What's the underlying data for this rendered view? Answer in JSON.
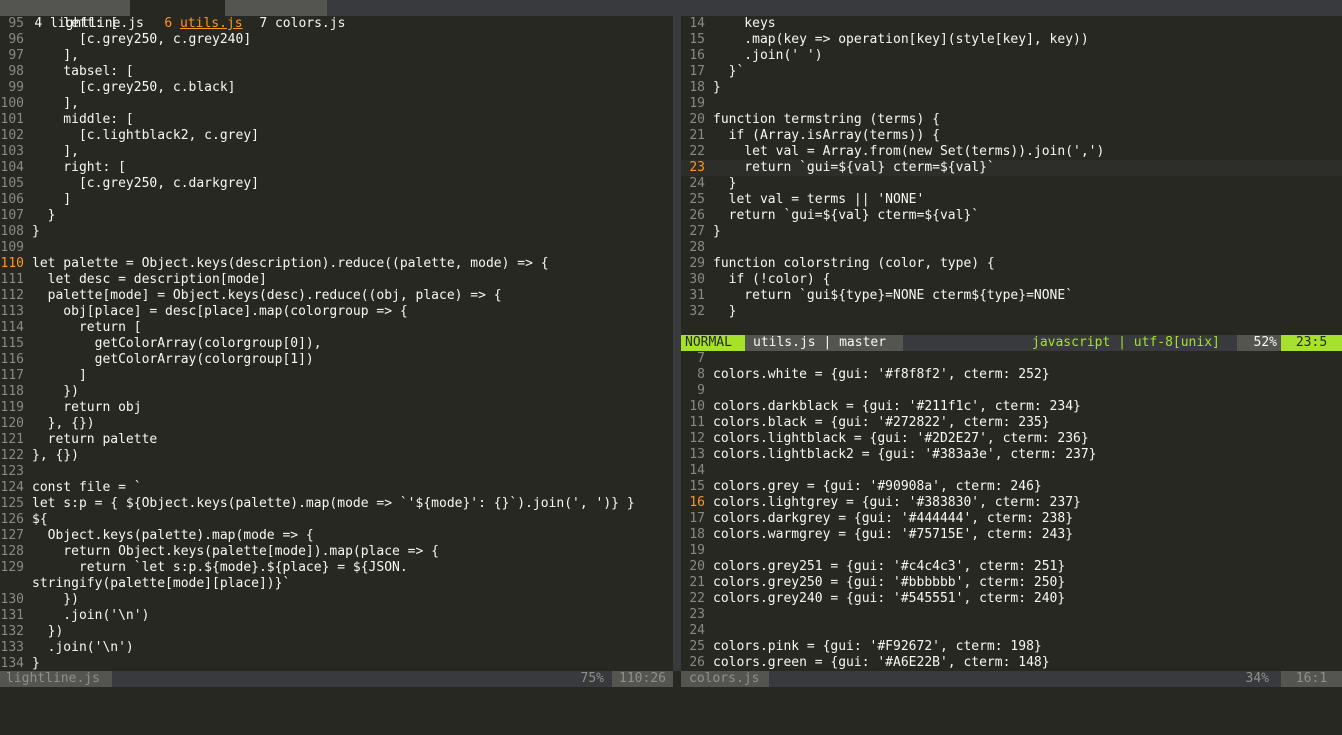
{
  "colors": {
    "bg": "#272822",
    "fg": "#f8f8f2",
    "grey": "#90908a",
    "pink": "#F92672",
    "green": "#A6E22B",
    "orange": "#FD971F",
    "yellow": "#E6DB74",
    "purple": "#AE81FF",
    "blue": "#66D9EF",
    "tabline_bg": "#383a3e"
  },
  "tabs": [
    {
      "number": "4",
      "name": "lightline.js",
      "active": false
    },
    {
      "number": "6",
      "name": "utils.js",
      "active": true
    },
    {
      "number": "7",
      "name": "colors.js",
      "active": false
    }
  ],
  "left_pane": {
    "filename": "lightline.js",
    "percent": "75%",
    "position": "110:26",
    "cursor_line": "110",
    "lines": [
      {
        "n": "95",
        "t": "    left: ["
      },
      {
        "n": "96",
        "t": "      [c.grey250, c.grey240]"
      },
      {
        "n": "97",
        "t": "    ],"
      },
      {
        "n": "98",
        "t": "    tabsel: ["
      },
      {
        "n": "99",
        "t": "      [c.grey250, c.black]"
      },
      {
        "n": "100",
        "t": "    ],"
      },
      {
        "n": "101",
        "t": "    middle: ["
      },
      {
        "n": "102",
        "t": "      [c.lightblack2, c.grey]"
      },
      {
        "n": "103",
        "t": "    ],"
      },
      {
        "n": "104",
        "t": "    right: ["
      },
      {
        "n": "105",
        "t": "      [c.grey250, c.darkgrey]"
      },
      {
        "n": "106",
        "t": "    ]"
      },
      {
        "n": "107",
        "t": "  }"
      },
      {
        "n": "108",
        "t": "}"
      },
      {
        "n": "109",
        "t": ""
      },
      {
        "n": "110",
        "t": "let palette = Object.keys(description).reduce((palette, mode) => {"
      },
      {
        "n": "111",
        "t": "  let desc = description[mode]"
      },
      {
        "n": "112",
        "t": "  palette[mode] = Object.keys(desc).reduce((obj, place) => {"
      },
      {
        "n": "113",
        "t": "    obj[place] = desc[place].map(colorgroup => {"
      },
      {
        "n": "114",
        "t": "      return ["
      },
      {
        "n": "115",
        "t": "        getColorArray(colorgroup[0]),"
      },
      {
        "n": "116",
        "t": "        getColorArray(colorgroup[1])"
      },
      {
        "n": "117",
        "t": "      ]"
      },
      {
        "n": "118",
        "t": "    })"
      },
      {
        "n": "119",
        "t": "    return obj"
      },
      {
        "n": "120",
        "t": "  }, {})"
      },
      {
        "n": "121",
        "t": "  return palette"
      },
      {
        "n": "122",
        "t": "}, {})"
      },
      {
        "n": "123",
        "t": ""
      },
      {
        "n": "124",
        "t": "const file = `"
      },
      {
        "n": "125",
        "t": "let s:p = { ${Object.keys(palette).map(mode => `'${mode}': {}`).join(', ')} }"
      },
      {
        "n": "126",
        "t": "${"
      },
      {
        "n": "127",
        "t": "  Object.keys(palette).map(mode => {"
      },
      {
        "n": "128",
        "t": "    return Object.keys(palette[mode]).map(place => {"
      },
      {
        "n": "129",
        "t": "      return `let s:p.${mode}.${place} = ${JSON."
      },
      {
        "n": "",
        "t": "stringify(palette[mode][place])}`"
      },
      {
        "n": "130",
        "t": "    })"
      },
      {
        "n": "131",
        "t": "    .join('\\n')"
      },
      {
        "n": "132",
        "t": "  })"
      },
      {
        "n": "133",
        "t": "  .join('\\n')"
      },
      {
        "n": "134",
        "t": "}"
      }
    ]
  },
  "right_top_pane": {
    "filename": "utils.js",
    "branch": "master",
    "mode": "NORMAL",
    "filetype": "javascript",
    "encoding": "utf-8[unix]",
    "percent": "52%",
    "position": "23:5",
    "cursor_line": "23",
    "lines": [
      {
        "n": "14",
        "t": "    keys"
      },
      {
        "n": "15",
        "t": "    .map(key => operation[key](style[key], key))"
      },
      {
        "n": "16",
        "t": "    .join(' ')"
      },
      {
        "n": "17",
        "t": "  }`"
      },
      {
        "n": "18",
        "t": "}"
      },
      {
        "n": "19",
        "t": ""
      },
      {
        "n": "20",
        "t": "function termstring (terms) {"
      },
      {
        "n": "21",
        "t": "  if (Array.isArray(terms)) {"
      },
      {
        "n": "22",
        "t": "    let val = Array.from(new Set(terms)).join(',')"
      },
      {
        "n": "23",
        "t": "    return `gui=${val} cterm=${val}`"
      },
      {
        "n": "24",
        "t": "  }"
      },
      {
        "n": "25",
        "t": "  let val = terms || 'NONE'"
      },
      {
        "n": "26",
        "t": "  return `gui=${val} cterm=${val}`"
      },
      {
        "n": "27",
        "t": "}"
      },
      {
        "n": "28",
        "t": ""
      },
      {
        "n": "29",
        "t": "function colorstring (color, type) {"
      },
      {
        "n": "30",
        "t": "  if (!color) {"
      },
      {
        "n": "31",
        "t": "    return `gui${type}=NONE cterm${type}=NONE`"
      },
      {
        "n": "32",
        "t": "  }"
      }
    ]
  },
  "right_bottom_pane": {
    "filename": "colors.js",
    "percent": "34%",
    "position": "16:1",
    "cursor_line": "16",
    "lines": [
      {
        "n": "7",
        "t": ""
      },
      {
        "n": "8",
        "t": "colors.white = {gui: '#f8f8f2', cterm: 252}"
      },
      {
        "n": "9",
        "t": ""
      },
      {
        "n": "10",
        "t": "colors.darkblack = {gui: '#211f1c', cterm: 234}"
      },
      {
        "n": "11",
        "t": "colors.black = {gui: '#272822', cterm: 235}"
      },
      {
        "n": "12",
        "t": "colors.lightblack = {gui: '#2D2E27', cterm: 236}"
      },
      {
        "n": "13",
        "t": "colors.lightblack2 = {gui: '#383a3e', cterm: 237}"
      },
      {
        "n": "14",
        "t": ""
      },
      {
        "n": "15",
        "t": "colors.grey = {gui: '#90908a', cterm: 246}"
      },
      {
        "n": "16",
        "t": "colors.lightgrey = {gui: '#383830', cterm: 237}"
      },
      {
        "n": "17",
        "t": "colors.darkgrey = {gui: '#444444', cterm: 238}"
      },
      {
        "n": "18",
        "t": "colors.warmgrey = {gui: '#75715E', cterm: 243}"
      },
      {
        "n": "19",
        "t": ""
      },
      {
        "n": "20",
        "t": "colors.grey251 = {gui: '#c4c4c3', cterm: 251}"
      },
      {
        "n": "21",
        "t": "colors.grey250 = {gui: '#bbbbbb', cterm: 250}"
      },
      {
        "n": "22",
        "t": "colors.grey240 = {gui: '#545551', cterm: 240}"
      },
      {
        "n": "23",
        "t": ""
      },
      {
        "n": "24",
        "t": ""
      },
      {
        "n": "25",
        "t": "colors.pink = {gui: '#F92672', cterm: 198}"
      },
      {
        "n": "26",
        "t": "colors.green = {gui: '#A6E22B', cterm: 148}"
      }
    ]
  }
}
